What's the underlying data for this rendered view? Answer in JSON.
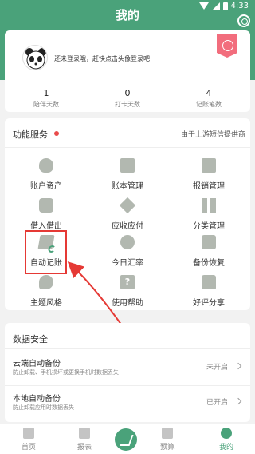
{
  "header": {
    "title": "我的"
  },
  "status_bar": {
    "time": "4:33"
  },
  "profile": {
    "login_prompt": "还未登录哦，赶快点击头像登录吧"
  },
  "stats": [
    {
      "value": "1",
      "label": "陪伴天数"
    },
    {
      "value": "0",
      "label": "打卡天数"
    },
    {
      "value": "4",
      "label": "记账笔数"
    }
  ],
  "functions": {
    "title": "功能服务",
    "note": "由于上游短信提供商",
    "items": [
      {
        "label": "账户资产",
        "icon": "money-bag-icon"
      },
      {
        "label": "账本管理",
        "icon": "ledger-book-icon"
      },
      {
        "label": "报销管理",
        "icon": "reimbursement-icon"
      },
      {
        "label": "借入借出",
        "icon": "lend-borrow-icon"
      },
      {
        "label": "应收应付",
        "icon": "receivable-payable-icon"
      },
      {
        "label": "分类管理",
        "icon": "category-grid-icon"
      },
      {
        "label": "自动记账",
        "icon": "auto-bookkeeping-icon"
      },
      {
        "label": "今日汇率",
        "icon": "exchange-rate-icon"
      },
      {
        "label": "备份恢复",
        "icon": "backup-restore-icon"
      },
      {
        "label": "主题风格",
        "icon": "palette-icon"
      },
      {
        "label": "使用帮助",
        "icon": "help-icon"
      },
      {
        "label": "好评分享",
        "icon": "thumbs-up-icon"
      }
    ]
  },
  "data_security": {
    "title": "数据安全",
    "rows": [
      {
        "title": "云端自动备份",
        "subtitle": "防止卸载、手机损坏或更换手机时数据丢失",
        "status": "未开启"
      },
      {
        "title": "本地自动备份",
        "subtitle": "防止卸载应用时数据丢失",
        "status": "已开启"
      }
    ]
  },
  "tabbar": [
    {
      "label": "首页"
    },
    {
      "label": "报表"
    },
    {
      "label": "预算"
    },
    {
      "label": "我的"
    }
  ],
  "colors": {
    "accent": "#4aa27a",
    "highlight": "#e53935"
  }
}
